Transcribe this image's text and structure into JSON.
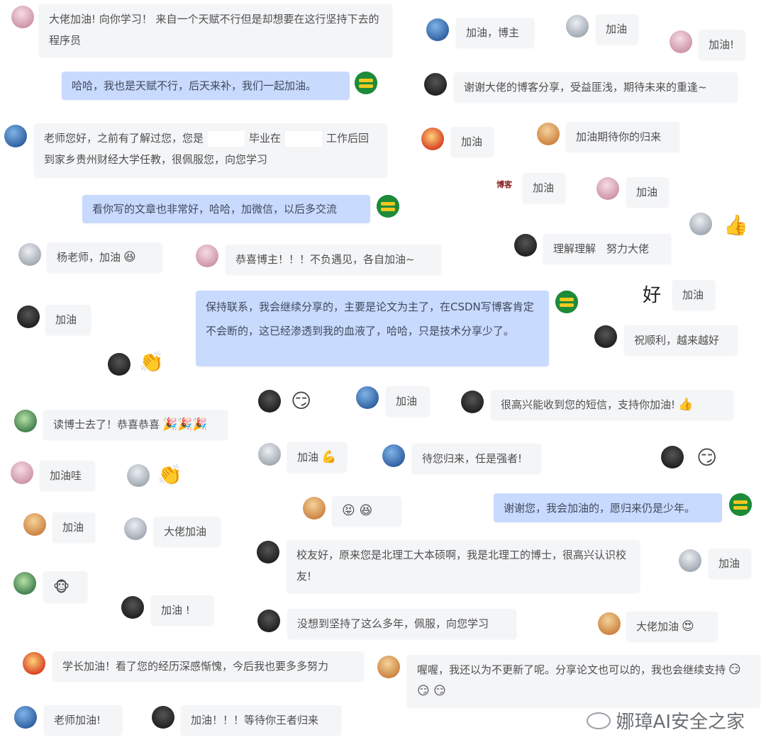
{
  "messages": [
    {
      "id": "m1",
      "text": "大佬加油! 向你学习！ 来自一个天赋不行但是却想要在这行坚持下去的程序员"
    },
    {
      "id": "m2",
      "text": "哈哈，我也是天赋不行，后天来补，我们一起加油。"
    },
    {
      "id": "m3a",
      "text": "老师您好，之前有了解过您，您是"
    },
    {
      "id": "m3b",
      "text": "毕业在"
    },
    {
      "id": "m3c",
      "text": "工作后回到家乡贵州财经大学任教，很佩服您，向您学习"
    },
    {
      "id": "m4",
      "text": "看你写的文章也非常好，哈哈，加微信，以后多交流"
    },
    {
      "id": "m5",
      "text": "杨老师，加油"
    },
    {
      "id": "m6",
      "text": "恭喜博主！！！不负遇见，各自加油~"
    },
    {
      "id": "m7",
      "text": "加油"
    },
    {
      "id": "m8",
      "text": "保持联系，我会继续分享的，主要是论文为主了，在CSDN写博客肯定不会断的，这已经渗透到我的血液了，哈哈，只是技术分享少了。"
    },
    {
      "id": "m9",
      "text": "读博士去了！恭喜恭喜"
    },
    {
      "id": "m10",
      "text": "加油"
    },
    {
      "id": "m11",
      "text": "很高兴能收到您的短信，支持你加油!"
    },
    {
      "id": "m12",
      "text": "加油"
    },
    {
      "id": "m13",
      "text": "待您归来，任是强者!"
    },
    {
      "id": "m14",
      "text": "加油哇"
    },
    {
      "id": "m15",
      "text": "谢谢您，我会加油的，愿归来仍是少年。"
    },
    {
      "id": "m16",
      "text": "加油"
    },
    {
      "id": "m17",
      "text": "大佬加油"
    },
    {
      "id": "m18",
      "text": "校友好，原来您是北理工大本硕啊，我是北理工的博士，很高兴认识校友!"
    },
    {
      "id": "m19",
      "text": "加油"
    },
    {
      "id": "m20",
      "text": "加油 !"
    },
    {
      "id": "m21",
      "text": "没想到坚持了这么多年，佩服，向您学习"
    },
    {
      "id": "m22",
      "text": "大佬加油"
    },
    {
      "id": "m23",
      "text": "学长加油！看了您的经历深感惭愧，今后我也要多多努力"
    },
    {
      "id": "m24",
      "text": "喔喔，我还以为不更新了呢。分享论文也可以的，我也会继续支持"
    },
    {
      "id": "m25",
      "text": "老师加油!"
    },
    {
      "id": "m26",
      "text": "加油！！！等待你王者归来"
    },
    {
      "id": "r1",
      "text": "加油，博主"
    },
    {
      "id": "r2",
      "text": "加油"
    },
    {
      "id": "r3",
      "text": "加油!"
    },
    {
      "id": "r4",
      "text": "谢谢大佬的博客分享，受益匪浅，期待未来的重逢~"
    },
    {
      "id": "r5",
      "text": "加油"
    },
    {
      "id": "r6",
      "text": "加油期待你的归来"
    },
    {
      "id": "r7",
      "text": "加油"
    },
    {
      "id": "r8",
      "text": "加油"
    },
    {
      "id": "r9",
      "text": "理解理解　努力大佬"
    },
    {
      "id": "r10",
      "text": "加油"
    },
    {
      "id": "r11",
      "text": "祝顺利，越来越好"
    }
  ],
  "labels": {
    "big_char": "好",
    "logo_avatar": "博客",
    "watermark": "娜璋AI安全之家"
  }
}
